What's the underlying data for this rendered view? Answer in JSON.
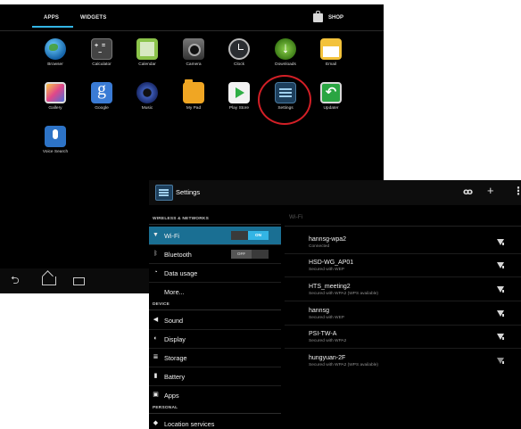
{
  "launcher": {
    "tabs": [
      {
        "label": "APPS"
      },
      {
        "label": "WIDGETS"
      }
    ],
    "shop_label": "SHOP",
    "apps": [
      {
        "label": "Browser",
        "icon": "browser-icon"
      },
      {
        "label": "Calculator",
        "icon": "calculator-icon"
      },
      {
        "label": "Calendar",
        "icon": "calendar-icon"
      },
      {
        "label": "Camera",
        "icon": "camera-icon"
      },
      {
        "label": "Clock",
        "icon": "clock-icon"
      },
      {
        "label": "Downloads",
        "icon": "downloads-icon"
      },
      {
        "label": "Email",
        "icon": "email-icon"
      },
      {
        "label": "Gallery",
        "icon": "gallery-icon"
      },
      {
        "label": "Google",
        "icon": "google-icon"
      },
      {
        "label": "Music",
        "icon": "music-icon"
      },
      {
        "label": "My Pad",
        "icon": "folder-icon"
      },
      {
        "label": "Play Store",
        "icon": "play-store-icon"
      },
      {
        "label": "Settings",
        "icon": "settings-icon"
      },
      {
        "label": "Updater",
        "icon": "updater-icon"
      },
      {
        "label": "Voice Search",
        "icon": "microphone-icon"
      }
    ],
    "accent": "#33b5e5",
    "highlight_color": "#d21f26"
  },
  "settings": {
    "title": "Settings",
    "sections": [
      {
        "title": "WIRELESS & NETWORKS"
      },
      {
        "title": "DEVICE"
      },
      {
        "title": "PERSONAL"
      }
    ],
    "items": [
      {
        "label": "Wi-Fi",
        "icon": "wifi-icon",
        "toggle": "ON",
        "selected": true
      },
      {
        "label": "Bluetooth",
        "icon": "bluetooth-icon",
        "toggle": "OFF"
      },
      {
        "label": "Data usage",
        "icon": "data-usage-icon"
      },
      {
        "label": "More...",
        "icon": ""
      },
      {
        "label": "Sound",
        "icon": "speaker-icon"
      },
      {
        "label": "Display",
        "icon": "display-icon"
      },
      {
        "label": "Storage",
        "icon": "storage-icon"
      },
      {
        "label": "Battery",
        "icon": "battery-icon"
      },
      {
        "label": "Apps",
        "icon": "apps-icon"
      },
      {
        "label": "Location services",
        "icon": "location-icon"
      }
    ],
    "wifi_header": "Wi-Fi",
    "networks": [
      {
        "ssid": "hannsg-wpa2",
        "status": "Connected"
      },
      {
        "ssid": "HSD-WG_AP01",
        "status": "Secured with WEP"
      },
      {
        "ssid": "HTS_meeting2",
        "status": "Secured with WPA2 (WPS available)"
      },
      {
        "ssid": "hannsg",
        "status": "Secured with WEP"
      },
      {
        "ssid": "PSI-TW-A",
        "status": "Secured with WPA2"
      },
      {
        "ssid": "hungyuan-2F",
        "status": "Secured with WPA2 (WPS available)"
      }
    ],
    "accent": "#33b5e5",
    "selected_row_color": "#1a6f93"
  }
}
